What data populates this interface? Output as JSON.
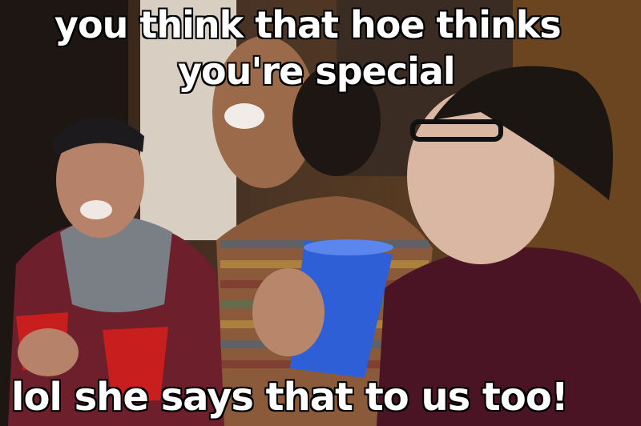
{
  "captions": {
    "top_line_1": "you think that hoe thinks",
    "top_line_2": "you're special",
    "bottom": "lol she says that to us too!"
  },
  "colors": {
    "caption_text": "#ffffff",
    "caption_outline": "#000000",
    "blue_cup": "#2f5fd6",
    "red_cup": "#c81e1e"
  }
}
